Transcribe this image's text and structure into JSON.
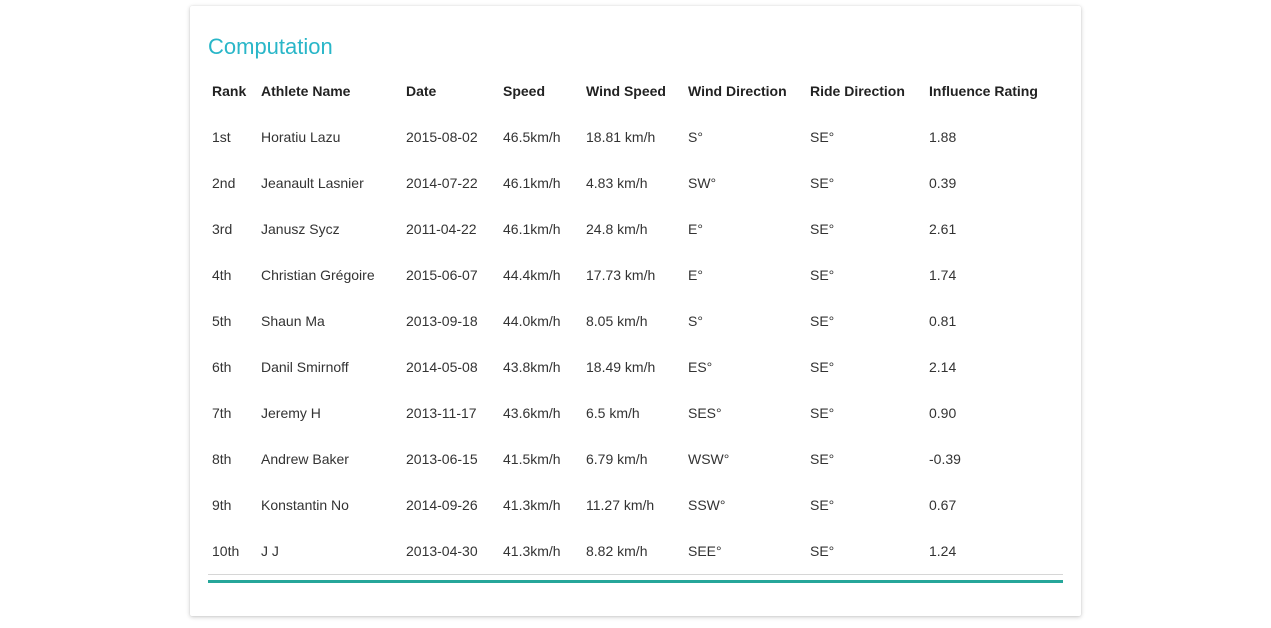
{
  "colors": {
    "title": "#29b6c8",
    "rule": "#26a69a"
  },
  "title": "Computation",
  "table": {
    "headers": [
      "Rank",
      "Athlete Name",
      "Date",
      "Speed",
      "Wind Speed",
      "Wind Direction",
      "Ride Direction",
      "Influence Rating"
    ],
    "rows": [
      [
        "1st",
        "Horatiu Lazu",
        "2015-08-02",
        "46.5km/h",
        "18.81 km/h",
        "S°",
        "SE°",
        "1.88"
      ],
      [
        "2nd",
        "Jeanault Lasnier",
        "2014-07-22",
        "46.1km/h",
        "4.83 km/h",
        "SW°",
        "SE°",
        "0.39"
      ],
      [
        "3rd",
        "Janusz Sycz",
        "2011-04-22",
        "46.1km/h",
        "24.8 km/h",
        "E°",
        "SE°",
        "2.61"
      ],
      [
        "4th",
        "Christian Grégoire",
        "2015-06-07",
        "44.4km/h",
        "17.73 km/h",
        "E°",
        "SE°",
        "1.74"
      ],
      [
        "5th",
        "Shaun Ma",
        "2013-09-18",
        "44.0km/h",
        "8.05 km/h",
        "S°",
        "SE°",
        "0.81"
      ],
      [
        "6th",
        "Danil Smirnoff",
        "2014-05-08",
        "43.8km/h",
        "18.49 km/h",
        "ES°",
        "SE°",
        "2.14"
      ],
      [
        "7th",
        "Jeremy H",
        "2013-11-17",
        "43.6km/h",
        "6.5 km/h",
        "SES°",
        "SE°",
        "0.90"
      ],
      [
        "8th",
        "Andrew Baker",
        "2013-06-15",
        "41.5km/h",
        "6.79 km/h",
        "WSW°",
        "SE°",
        "-0.39"
      ],
      [
        "9th",
        "Konstantin No",
        "2014-09-26",
        "41.3km/h",
        "11.27 km/h",
        "SSW°",
        "SE°",
        "0.67"
      ],
      [
        "10th",
        "J J",
        "2013-04-30",
        "41.3km/h",
        "8.82 km/h",
        "SEE°",
        "SE°",
        "1.24"
      ]
    ]
  }
}
